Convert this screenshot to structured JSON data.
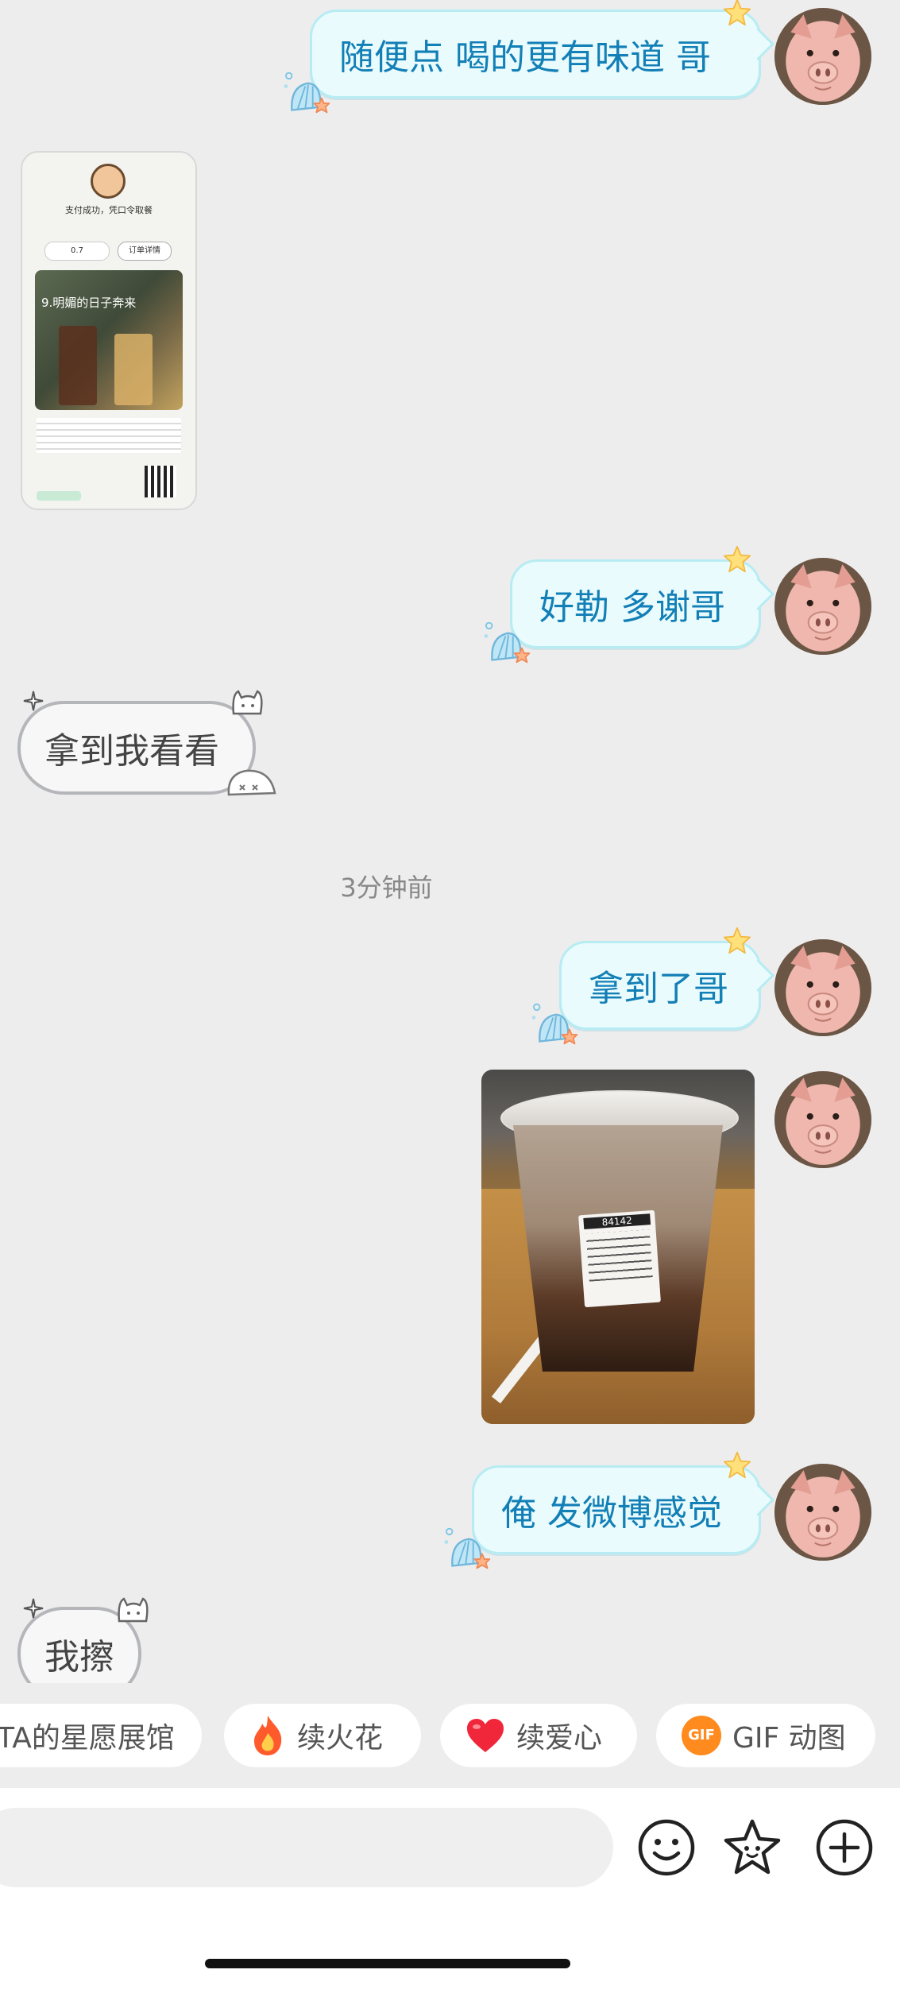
{
  "messages": {
    "m1": "随便点 喝的更有味道 哥",
    "m2": "好勒 多谢哥",
    "m3": "拿到我看看",
    "timestamp": "3分钟前",
    "m4": "拿到了哥",
    "m5": "俺 发微博感觉",
    "m6": "我擦"
  },
  "shared_screenshot": {
    "status": "支付成功，凭口令取餐",
    "slogan": "9.明媚的日子奔来",
    "button": "订单详情",
    "points": "0.7"
  },
  "drink_label": "84142",
  "shortcuts": {
    "chip1": "TA的星愿展馆",
    "chip2": "续火花",
    "chip3": "续爱心",
    "chip4_badge": "GIF",
    "chip4": "GIF 动图"
  },
  "icons": {
    "emoji": "smiley-icon",
    "sticker": "star-sticker-icon",
    "add": "plus-circle-icon"
  },
  "colors": {
    "outgoing_bubble": "#e9fbfd",
    "outgoing_text": "#127fb6",
    "incoming_bubble": "#f7f7f7",
    "background": "#ededed"
  }
}
